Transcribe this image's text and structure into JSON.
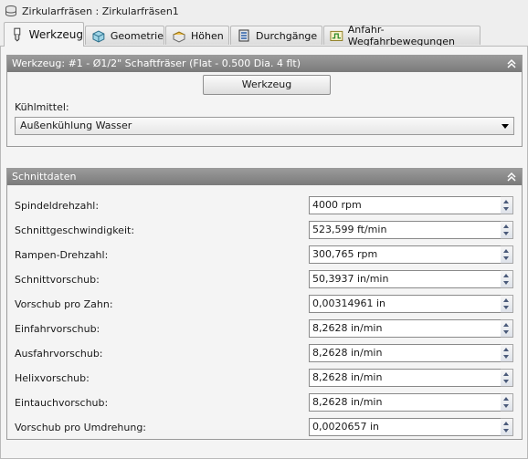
{
  "window": {
    "title": "Zirkularfräsen : Zirkularfräsen1"
  },
  "tabs": [
    {
      "label": "Werkzeug",
      "icon": "tool-icon"
    },
    {
      "label": "Geometrie",
      "icon": "geometry-icon"
    },
    {
      "label": "Höhen",
      "icon": "heights-icon"
    },
    {
      "label": "Durchgänge",
      "icon": "passes-icon"
    },
    {
      "label": "Anfahr-Wegfahrbewegungen",
      "icon": "linking-icon"
    }
  ],
  "tool_section": {
    "header": "Werkzeug: #1 - Ø1/2\" Schaftfräser (Flat - 0.500 Dia. 4 flt)",
    "button_label": "Werkzeug",
    "coolant_label": "Kühlmittel:",
    "coolant_value": "Außenkühlung Wasser"
  },
  "cut_section": {
    "header": "Schnittdaten",
    "rows": [
      {
        "label": "Spindeldrehzahl:",
        "value": "4000 rpm"
      },
      {
        "label": "Schnittgeschwindigkeit:",
        "value": "523,599 ft/min"
      },
      {
        "label": "Rampen-Drehzahl:",
        "value": "300,765 rpm"
      },
      {
        "label": "Schnittvorschub:",
        "value": "50,3937 in/min"
      },
      {
        "label": "Vorschub pro Zahn:",
        "value": "0,00314961 in"
      },
      {
        "label": "Einfahrvorschub:",
        "value": "8,2628 in/min"
      },
      {
        "label": "Ausfahrvorschub:",
        "value": "8,2628 in/min"
      },
      {
        "label": "Helixvorschub:",
        "value": "8,2628 in/min"
      },
      {
        "label": "Eintauchvorschub:",
        "value": "8,2628 in/min"
      },
      {
        "label": "Vorschub pro Umdrehung:",
        "value": "0,0020657 in"
      }
    ]
  },
  "colors": {
    "section_header": "#8a8a8a",
    "panel_bg": "#f4f4f4"
  }
}
